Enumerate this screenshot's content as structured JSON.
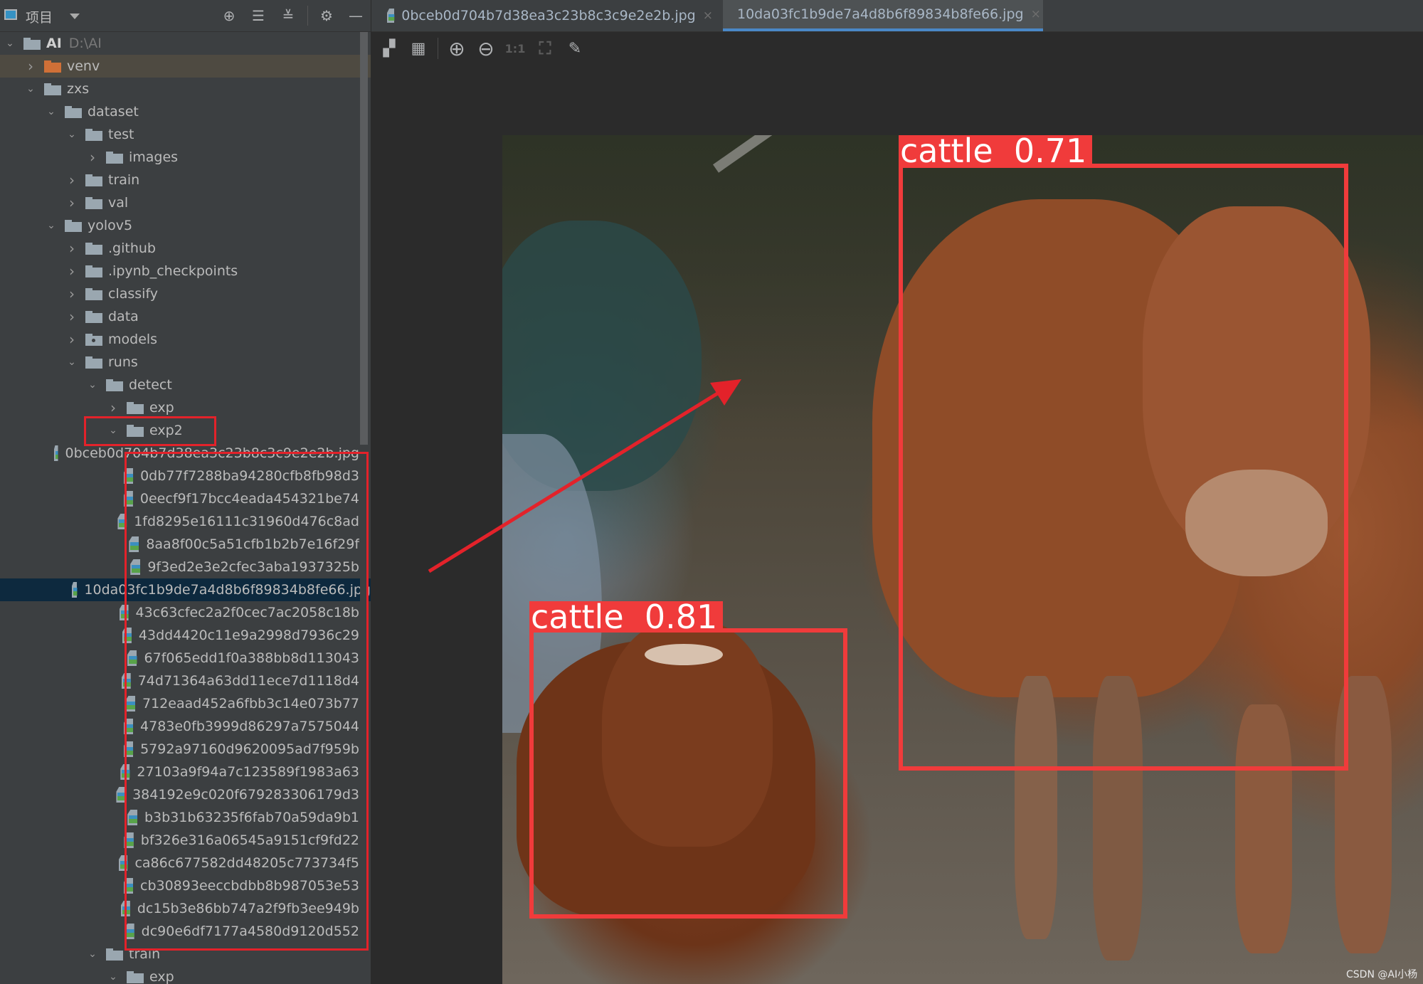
{
  "project_panel": {
    "title": "项目",
    "header_buttons": [
      "locate-icon",
      "expand-all-icon",
      "collapse-all-icon",
      "gear-icon",
      "minimize-icon"
    ],
    "tree": [
      {
        "label": "AI",
        "path": "D:\\AI",
        "level": 0,
        "expanded": true,
        "type": "folder",
        "bold": true
      },
      {
        "label": "venv",
        "level": 1,
        "expanded": false,
        "type": "folder",
        "variant": "excluded"
      },
      {
        "label": "zxs",
        "level": 1,
        "expanded": true,
        "type": "folder"
      },
      {
        "label": "dataset",
        "level": 2,
        "expanded": true,
        "type": "folder"
      },
      {
        "label": "test",
        "level": 3,
        "expanded": true,
        "type": "folder"
      },
      {
        "label": "images",
        "level": 4,
        "expanded": false,
        "type": "folder"
      },
      {
        "label": "train",
        "level": 3,
        "expanded": false,
        "type": "folder"
      },
      {
        "label": "val",
        "level": 3,
        "expanded": false,
        "type": "folder"
      },
      {
        "label": "yolov5",
        "level": 2,
        "expanded": true,
        "type": "folder"
      },
      {
        "label": ".github",
        "level": 3,
        "expanded": false,
        "type": "folder"
      },
      {
        "label": ".ipynb_checkpoints",
        "level": 3,
        "expanded": false,
        "type": "folder"
      },
      {
        "label": "classify",
        "level": 3,
        "expanded": false,
        "type": "folder"
      },
      {
        "label": "data",
        "level": 3,
        "expanded": false,
        "type": "folder"
      },
      {
        "label": "models",
        "level": 3,
        "expanded": false,
        "type": "package"
      },
      {
        "label": "runs",
        "level": 3,
        "expanded": true,
        "type": "folder"
      },
      {
        "label": "detect",
        "level": 4,
        "expanded": true,
        "type": "folder"
      },
      {
        "label": "exp",
        "level": 5,
        "expanded": false,
        "type": "folder"
      },
      {
        "label": "exp2",
        "level": 5,
        "expanded": true,
        "type": "folder",
        "highlighted": true
      },
      {
        "label": "0bceb0d704b7d38ea3c23b8c3c9e2e2b.jpg",
        "level": 6,
        "type": "image"
      },
      {
        "label": "0db77f7288ba94280cfb8fb98d3",
        "level": 6,
        "type": "image"
      },
      {
        "label": "0eecf9f17bcc4eada454321be74",
        "level": 6,
        "type": "image"
      },
      {
        "label": "1fd8295e16111c31960d476c8ad",
        "level": 6,
        "type": "image"
      },
      {
        "label": "8aa8f00c5a51cfb1b2b7e16f29f",
        "level": 6,
        "type": "image"
      },
      {
        "label": "9f3ed2e3e2cfec3aba1937325b",
        "level": 6,
        "type": "image"
      },
      {
        "label": "10da03fc1b9de7a4d8b6f89834b8fe66.jpg",
        "level": 6,
        "type": "image",
        "selected": true
      },
      {
        "label": "43c63cfec2a2f0cec7ac2058c18b",
        "level": 6,
        "type": "image"
      },
      {
        "label": "43dd4420c11e9a2998d7936c29",
        "level": 6,
        "type": "image"
      },
      {
        "label": "67f065edd1f0a388bb8d113043",
        "level": 6,
        "type": "image"
      },
      {
        "label": "74d71364a63dd11ece7d1118d4",
        "level": 6,
        "type": "image"
      },
      {
        "label": "712eaad452a6fbb3c14e073b77",
        "level": 6,
        "type": "image"
      },
      {
        "label": "4783e0fb3999d86297a7575044",
        "level": 6,
        "type": "image"
      },
      {
        "label": "5792a97160d9620095ad7f959b",
        "level": 6,
        "type": "image"
      },
      {
        "label": "27103a9f94a7c123589f1983a63",
        "level": 6,
        "type": "image"
      },
      {
        "label": "384192e9c020f679283306179d3",
        "level": 6,
        "type": "image"
      },
      {
        "label": "b3b31b63235f6fab70a59da9b1",
        "level": 6,
        "type": "image"
      },
      {
        "label": "bf326e316a06545a9151cf9fd22",
        "level": 6,
        "type": "image"
      },
      {
        "label": "ca86c677582dd48205c773734f5",
        "level": 6,
        "type": "image"
      },
      {
        "label": "cb30893eeccbdbb8b987053e53",
        "level": 6,
        "type": "image"
      },
      {
        "label": "dc15b3e86bb747a2f9fb3ee949b",
        "level": 6,
        "type": "image"
      },
      {
        "label": "dc90e6df7177a4580d9120d552",
        "level": 6,
        "type": "image"
      },
      {
        "label": "train",
        "level": 4,
        "expanded": true,
        "type": "folder"
      },
      {
        "label": "exp",
        "level": 5,
        "expanded": true,
        "type": "folder"
      }
    ]
  },
  "tabs": [
    {
      "label": "0bceb0d704b7d38ea3c23b8c3c9e2e2b.jpg",
      "active": false
    },
    {
      "label": "10da03fc1b9de7a4d8b6f89834b8fe66.jpg",
      "active": true
    }
  ],
  "image_toolbar": {
    "buttons": [
      {
        "name": "chessboard-icon",
        "glyph": "▞",
        "enabled": true
      },
      {
        "name": "grid-icon",
        "glyph": "▦",
        "enabled": true
      },
      {
        "name": "zoom-in-icon",
        "glyph": "⊕",
        "enabled": true
      },
      {
        "name": "zoom-out-icon",
        "glyph": "⊖",
        "enabled": true
      },
      {
        "name": "actual-size-icon",
        "glyph": "1:1",
        "enabled": false
      },
      {
        "name": "fit-window-icon",
        "glyph": "⛶",
        "enabled": false
      },
      {
        "name": "color-picker-icon",
        "glyph": "✎",
        "enabled": true
      }
    ]
  },
  "detections": [
    {
      "label": "cattle  0.71",
      "class": "cattle",
      "confidence": 0.71
    },
    {
      "label": "cattle  0.81",
      "class": "cattle",
      "confidence": 0.81
    }
  ],
  "watermark": "CSDN @AI小杨",
  "colors": {
    "panel_bg": "#3c3f41",
    "editor_bg": "#2b2b2b",
    "selection": "#0d293e",
    "active_tab_underline": "#4a88c7",
    "annotation_red": "#e3222a",
    "detection_red": "#f03b3b"
  }
}
